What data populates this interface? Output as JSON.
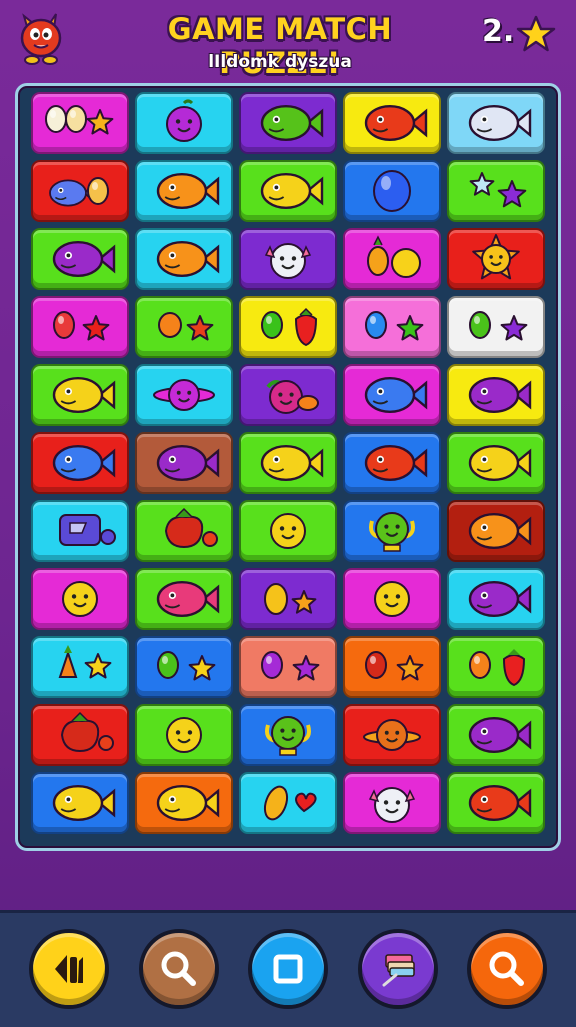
{
  "header": {
    "title": "GAME MATCH PUZZL!",
    "subtitle": "lIldomk dyszua",
    "score": "2."
  },
  "colors": {
    "magenta": "#e52ad6",
    "cyan": "#27d3f0",
    "purple": "#7d2bd0",
    "yellow": "#f7ea10",
    "lightblue": "#7fd7f7",
    "red": "#e8201b",
    "green": "#58e01c",
    "blue": "#2377ee",
    "white": "#f2f2f2",
    "pink": "#f56fd9",
    "orange": "#f56a0e",
    "brown": "#b35a3a",
    "darkred": "#b31f10",
    "salmon": "#f07a64"
  },
  "board": {
    "rows": [
      [
        {
          "color": "magenta",
          "icon": "fruit-star"
        },
        {
          "color": "cyan",
          "icon": "purple-fruit"
        },
        {
          "color": "purple",
          "icon": "green-fish"
        },
        {
          "color": "yellow",
          "icon": "red-fish"
        },
        {
          "color": "lightblue",
          "icon": "white-fish"
        }
      ],
      [
        {
          "color": "red",
          "icon": "blue-creature"
        },
        {
          "color": "cyan",
          "icon": "orange-fish"
        },
        {
          "color": "green",
          "icon": "yellow-fish"
        },
        {
          "color": "blue",
          "icon": "blue-balloon"
        },
        {
          "color": "green",
          "icon": "star-pair"
        }
      ],
      [
        {
          "color": "green",
          "icon": "purple-fish"
        },
        {
          "color": "cyan",
          "icon": "orange-fish"
        },
        {
          "color": "purple",
          "icon": "white-creature"
        },
        {
          "color": "magenta",
          "icon": "pineapple-fruit"
        },
        {
          "color": "red",
          "icon": "sun-face"
        }
      ],
      [
        {
          "color": "magenta",
          "icon": "red-balloon-star"
        },
        {
          "color": "green",
          "icon": "orange-star"
        },
        {
          "color": "yellow",
          "icon": "green-strawberry"
        },
        {
          "color": "pink",
          "icon": "blue-balloon-star"
        },
        {
          "color": "white",
          "icon": "green-purple-star"
        }
      ],
      [
        {
          "color": "green",
          "icon": "yellow-creature"
        },
        {
          "color": "cyan",
          "icon": "planet-face"
        },
        {
          "color": "purple",
          "icon": "fruit-mix"
        },
        {
          "color": "magenta",
          "icon": "blue-fish"
        },
        {
          "color": "yellow",
          "icon": "purple-fish"
        }
      ],
      [
        {
          "color": "red",
          "icon": "blue-fish"
        },
        {
          "color": "brown",
          "icon": "purple-fish"
        },
        {
          "color": "green",
          "icon": "yellow-fish"
        },
        {
          "color": "blue",
          "icon": "red-fish"
        },
        {
          "color": "green",
          "icon": "yellow-fish"
        }
      ],
      [
        {
          "color": "cyan",
          "icon": "blue-box"
        },
        {
          "color": "green",
          "icon": "red-tomato"
        },
        {
          "color": "green",
          "icon": "yellow-face"
        },
        {
          "color": "blue",
          "icon": "green-trophy"
        },
        {
          "color": "darkred",
          "icon": "orange-fish"
        }
      ],
      [
        {
          "color": "magenta",
          "icon": "yellow-face"
        },
        {
          "color": "green",
          "icon": "pink-fish"
        },
        {
          "color": "purple",
          "icon": "yellow-fruit"
        },
        {
          "color": "magenta",
          "icon": "yellow-face"
        },
        {
          "color": "cyan",
          "icon": "purple-fish"
        }
      ],
      [
        {
          "color": "cyan",
          "icon": "carrot-star"
        },
        {
          "color": "blue",
          "icon": "green-star"
        },
        {
          "color": "salmon",
          "icon": "purple-star"
        },
        {
          "color": "orange",
          "icon": "red-star"
        },
        {
          "color": "green",
          "icon": "orange-strawberry"
        }
      ],
      [
        {
          "color": "red",
          "icon": "red-tomato"
        },
        {
          "color": "green",
          "icon": "yellow-face"
        },
        {
          "color": "blue",
          "icon": "green-trophy"
        },
        {
          "color": "red",
          "icon": "orange-planet"
        },
        {
          "color": "green",
          "icon": "purple-fish"
        }
      ],
      [
        {
          "color": "blue",
          "icon": "yellow-fish"
        },
        {
          "color": "orange",
          "icon": "yellow-fish"
        },
        {
          "color": "cyan",
          "icon": "fruit-heart"
        },
        {
          "color": "magenta",
          "icon": "white-creature"
        },
        {
          "color": "green",
          "icon": "red-fish"
        }
      ]
    ]
  },
  "footer": {
    "buttons": [
      {
        "name": "undo-button",
        "icon": "undo-icon",
        "color": "#ffd21a"
      },
      {
        "name": "hint-button",
        "icon": "magnifier-icon",
        "color": "#b07044"
      },
      {
        "name": "stop-button",
        "icon": "square-icon",
        "color": "#1aa3f0"
      },
      {
        "name": "shuffle-button",
        "icon": "cards-icon",
        "color": "#7a3ad0"
      },
      {
        "name": "search-button",
        "icon": "magnifier-icon",
        "color": "#f5670c"
      }
    ]
  }
}
